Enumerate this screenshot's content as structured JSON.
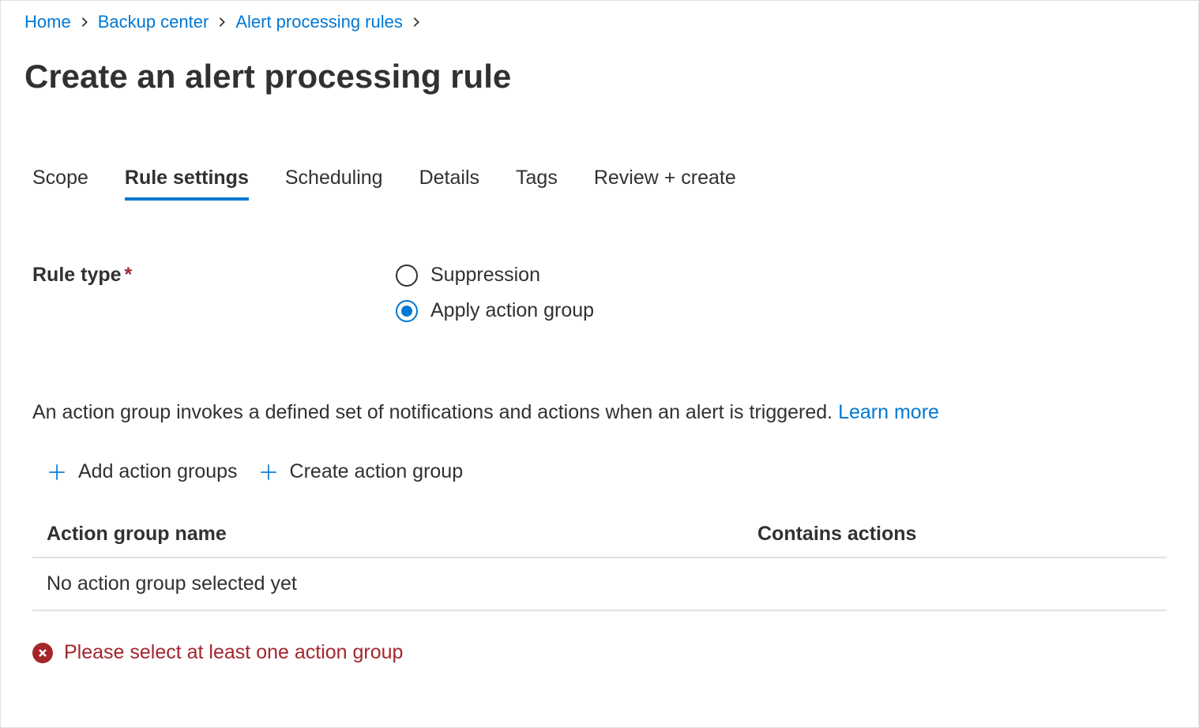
{
  "breadcrumb": {
    "items": [
      {
        "label": "Home"
      },
      {
        "label": "Backup center"
      },
      {
        "label": "Alert processing rules"
      }
    ]
  },
  "page": {
    "title": "Create an alert processing rule"
  },
  "tabs": [
    {
      "label": "Scope",
      "active": false
    },
    {
      "label": "Rule settings",
      "active": true
    },
    {
      "label": "Scheduling",
      "active": false
    },
    {
      "label": "Details",
      "active": false
    },
    {
      "label": "Tags",
      "active": false
    },
    {
      "label": "Review + create",
      "active": false
    }
  ],
  "form": {
    "rule_type_label": "Rule type",
    "required_marker": "*",
    "options": [
      {
        "label": "Suppression",
        "selected": false
      },
      {
        "label": "Apply action group",
        "selected": true
      }
    ]
  },
  "description": {
    "text": "An action group invokes a defined set of notifications and actions when an alert is triggered. ",
    "link_text": "Learn more"
  },
  "actions": {
    "add_label": "Add action groups",
    "create_label": "Create action group"
  },
  "table": {
    "columns": {
      "name": "Action group name",
      "actions": "Contains actions"
    },
    "empty_text": "No action group selected yet"
  },
  "error": {
    "text": "Please select at least one action group"
  }
}
